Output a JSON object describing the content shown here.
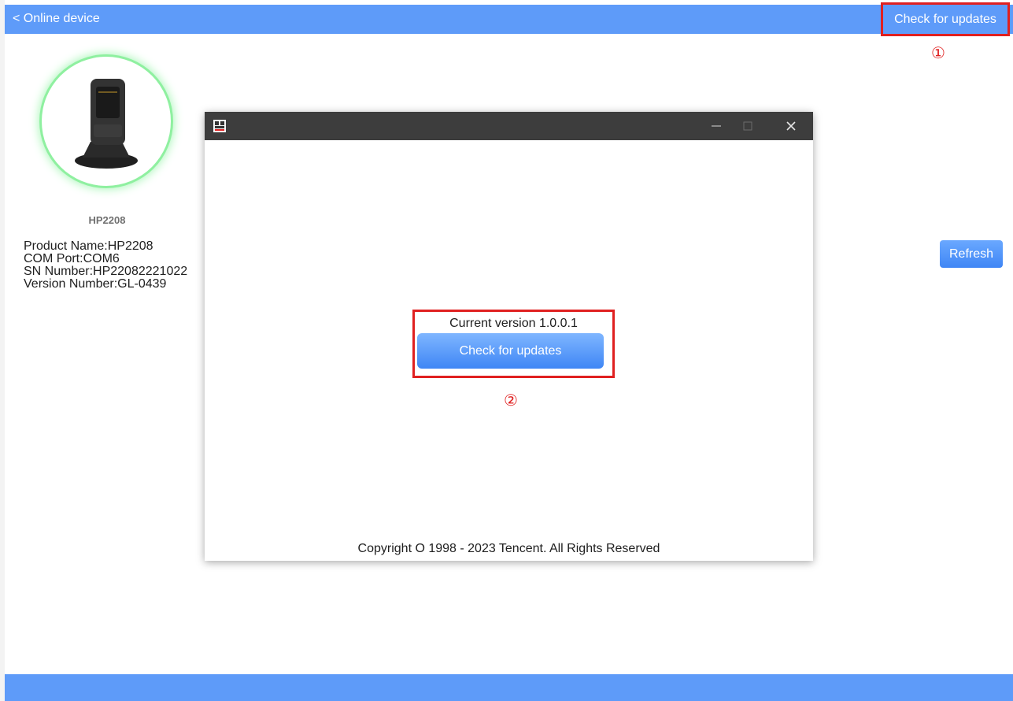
{
  "topbar": {
    "back_label": "< Online device",
    "check_updates_label": "Check for updates"
  },
  "annotations": {
    "marker1": "①",
    "marker2": "②"
  },
  "device": {
    "caption": "HP2208",
    "product_name": "Product Name:HP2208",
    "com_port": "COM Port:COM6",
    "sn_number": "SN Number:HP22082221022",
    "version_number": "Version Number:GL-0439"
  },
  "refresh_label": "Refresh",
  "dialog": {
    "current_version": "Current version 1.0.0.1",
    "check_button_label": "Check for updates",
    "copyright": "Copyright O 1998 - 2023 Tencent. All Rights Reserved"
  },
  "colors": {
    "accent": "#5e9bf9",
    "highlight": "#e02020",
    "titlebar": "#3d3d3d"
  },
  "icons": [
    "app-icon",
    "minimize-icon",
    "maximize-icon",
    "close-icon",
    "scanner-device-icon"
  ]
}
